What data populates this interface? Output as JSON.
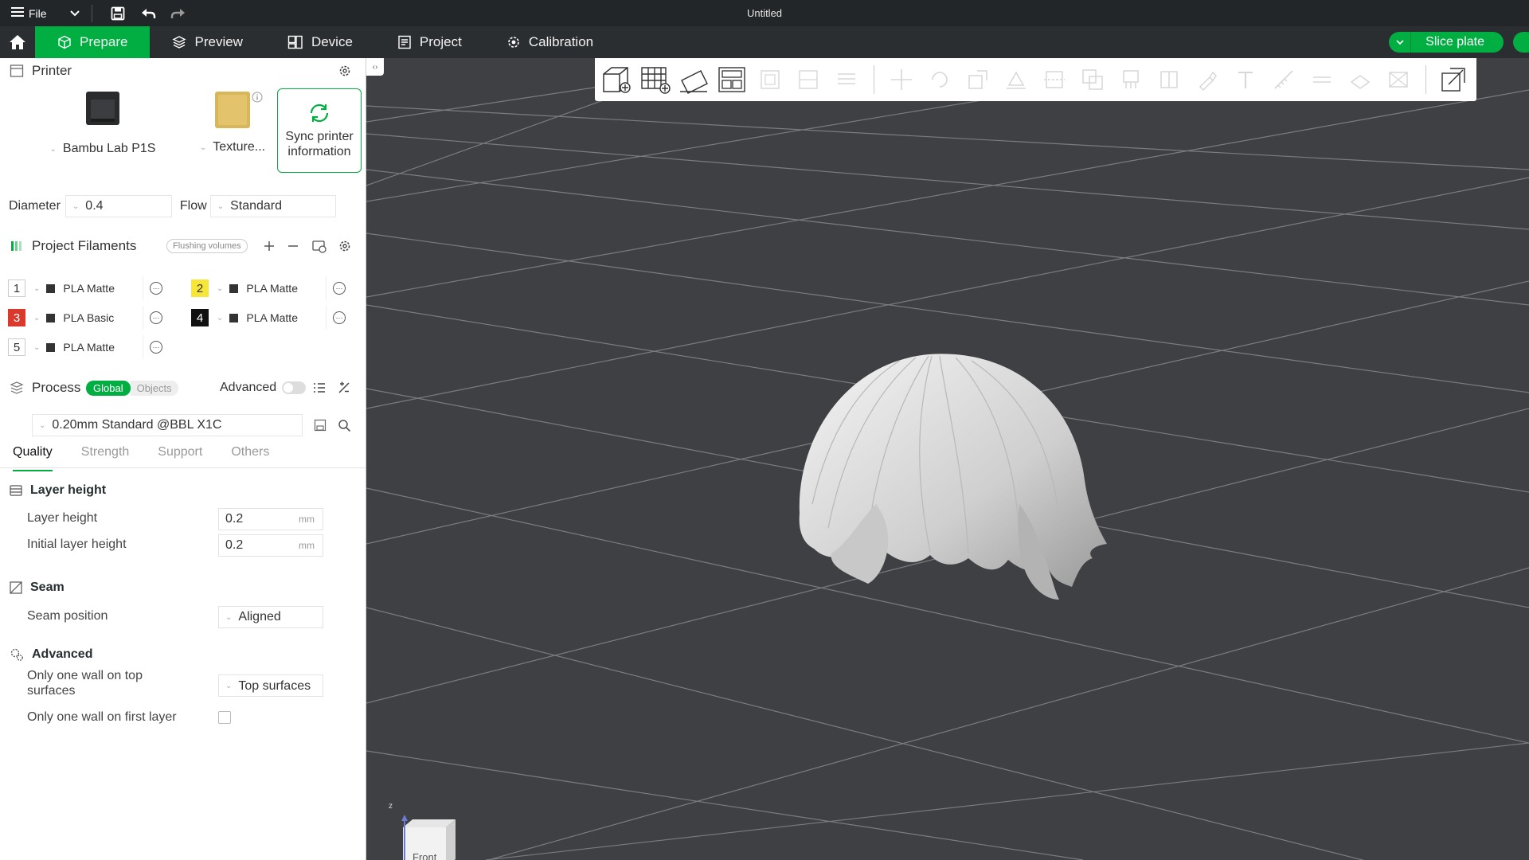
{
  "titlebar": {
    "menu_label": "File",
    "window_title": "Untitled"
  },
  "tabs": [
    {
      "label": "Prepare",
      "icon": "cube-icon",
      "active": true
    },
    {
      "label": "Preview",
      "icon": "layers-icon",
      "active": false
    },
    {
      "label": "Device",
      "icon": "device-icon",
      "active": false
    },
    {
      "label": "Project",
      "icon": "project-icon",
      "active": false
    },
    {
      "label": "Calibration",
      "icon": "calibration-icon",
      "active": false
    }
  ],
  "slice_button": "Slice plate",
  "printer": {
    "section_label": "Printer",
    "printer_name": "Bambu Lab P1S",
    "plate_name": "Texture...",
    "sync_label_1": "Sync printer",
    "sync_label_2": "information",
    "diameter_label": "Diameter",
    "diameter_value": "0.4",
    "flow_label": "Flow",
    "flow_value": "Standard"
  },
  "filaments": {
    "section_label": "Project Filaments",
    "flushing_label": "Flushing volumes",
    "items": [
      {
        "num": "1",
        "name": "PLA Matte",
        "color": "#ffffff",
        "text_color": "#333333"
      },
      {
        "num": "2",
        "name": "PLA Matte",
        "color": "#f5e639",
        "text_color": "#333333"
      },
      {
        "num": "3",
        "name": "PLA Basic",
        "color": "#d93a2b",
        "text_color": "#ffffff"
      },
      {
        "num": "4",
        "name": "PLA Matte",
        "color": "#111111",
        "text_color": "#ffffff"
      },
      {
        "num": "5",
        "name": "PLA Matte",
        "color": "#ffffff",
        "text_color": "#333333"
      }
    ]
  },
  "process": {
    "section_label": "Process",
    "toggle_global": "Global",
    "toggle_objects": "Objects",
    "advanced_label": "Advanced",
    "preset": "0.20mm Standard @BBL X1C",
    "subtabs": [
      "Quality",
      "Strength",
      "Support",
      "Others"
    ],
    "layer_height_group": "Layer height",
    "layer_height_label": "Layer height",
    "layer_height_value": "0.2",
    "initial_layer_height_label": "Initial layer height",
    "initial_layer_height_value": "0.2",
    "unit_mm": "mm",
    "seam_group": "Seam",
    "seam_position_label": "Seam position",
    "seam_position_value": "Aligned",
    "advanced_group": "Advanced",
    "one_wall_top_label_1": "Only one wall on top",
    "one_wall_top_label_2": "surfaces",
    "one_wall_top_value": "Top surfaces",
    "one_wall_first_label": "Only one wall on first layer"
  },
  "viewport": {
    "navcube_label": "Front",
    "axis_label": "z"
  },
  "colors": {
    "accent": "#00ae42",
    "titlebar": "#232628",
    "tabbar": "#2b2e31",
    "plate": "#3f4043",
    "grid_line": "#7d7e81"
  }
}
